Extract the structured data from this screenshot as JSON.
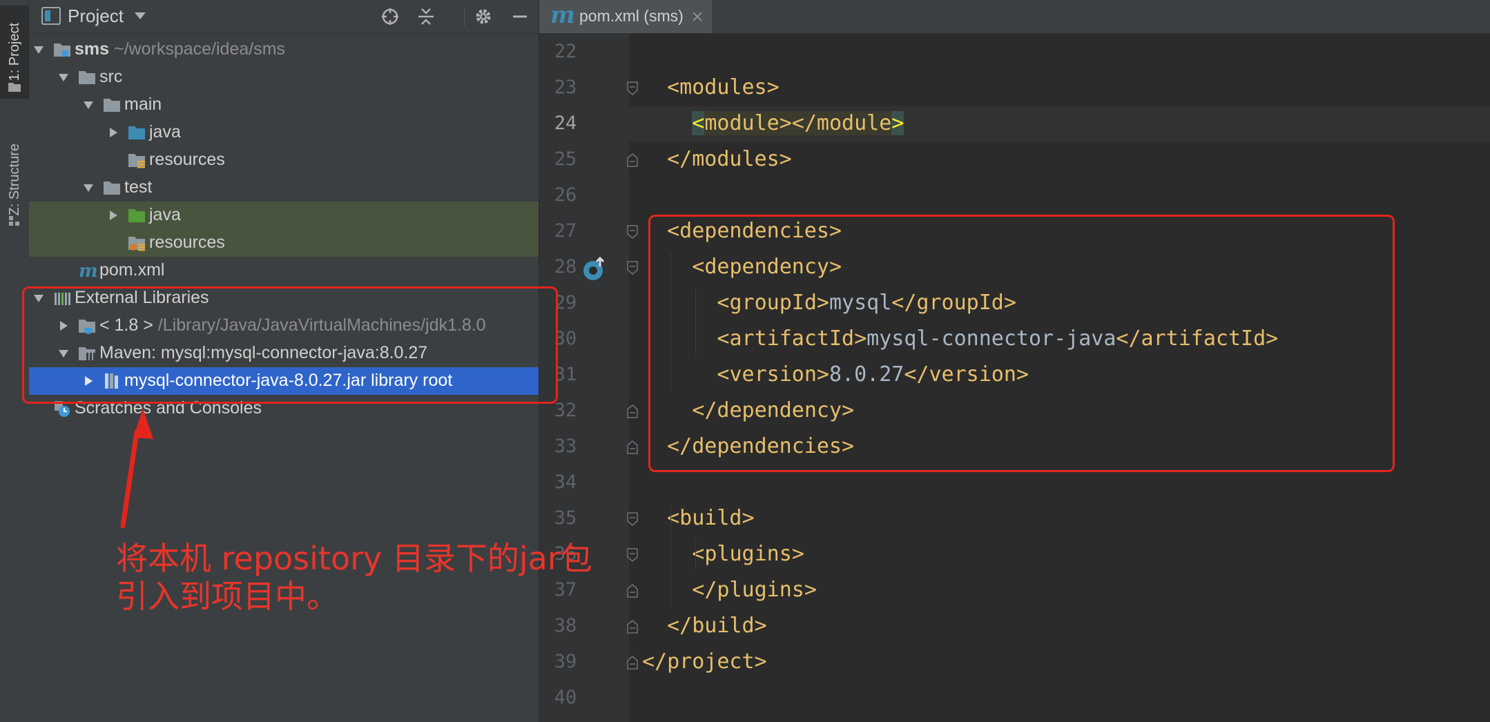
{
  "tool_window_tabs": [
    {
      "label": "1: Project",
      "active": true
    },
    {
      "label": "Z: Structure",
      "active": false
    }
  ],
  "project_panel": {
    "title": "Project",
    "header_icons": [
      "crosshair-icon",
      "collapse-all-icon",
      "gear-icon",
      "minimize-icon"
    ],
    "tree": [
      {
        "id": "sms",
        "level": 0,
        "expanded": true,
        "icon": "module-folder-icon",
        "label": "sms",
        "bold": true,
        "hint": "~/workspace/idea/sms"
      },
      {
        "id": "src",
        "level": 1,
        "expanded": true,
        "icon": "folder-icon",
        "label": "src",
        "hint": ""
      },
      {
        "id": "main",
        "level": 2,
        "expanded": true,
        "icon": "folder-icon",
        "label": "main",
        "hint": ""
      },
      {
        "id": "main-java",
        "level": 3,
        "expanded": false,
        "icon": "source-root-folder-icon",
        "label": "java",
        "hint": ""
      },
      {
        "id": "main-resources",
        "level": 3,
        "expanded": null,
        "icon": "resources-folder-icon",
        "label": "resources",
        "hint": ""
      },
      {
        "id": "test",
        "level": 2,
        "expanded": true,
        "icon": "folder-icon",
        "label": "test",
        "hint": ""
      },
      {
        "id": "test-java",
        "level": 3,
        "expanded": false,
        "icon": "test-source-folder-icon",
        "label": "java",
        "hint": "",
        "highlight": "test"
      },
      {
        "id": "test-resources",
        "level": 3,
        "expanded": null,
        "icon": "test-resources-folder-icon",
        "label": "resources",
        "hint": "",
        "highlight": "test"
      },
      {
        "id": "pom",
        "level": 1,
        "expanded": null,
        "icon": "maven-file-icon",
        "label": "pom.xml",
        "hint": ""
      },
      {
        "id": "ext-libs",
        "level": 0,
        "expanded": true,
        "icon": "libraries-icon",
        "label": "External Libraries",
        "hint": ""
      },
      {
        "id": "jdk",
        "level": 1,
        "expanded": false,
        "icon": "jdk-icon",
        "label": "< 1.8 >",
        "hint": "/Library/Java/JavaVirtualMachines/jdk1.8.0"
      },
      {
        "id": "maven-lib",
        "level": 1,
        "expanded": true,
        "icon": "library-icon",
        "label": "Maven: mysql:mysql-connector-java:8.0.27",
        "hint": ""
      },
      {
        "id": "jar",
        "level": 2,
        "expanded": false,
        "icon": "jar-icon",
        "label": "mysql-connector-java-8.0.27.jar",
        "hint": "library root",
        "selected": true
      },
      {
        "id": "scratches",
        "level": 0,
        "expanded": null,
        "icon": "scratches-icon",
        "label": "Scratches and Consoles",
        "hint": ""
      }
    ]
  },
  "editor": {
    "tab_label": "pom.xml (sms)",
    "tab_icon": "maven-file-icon",
    "current_line": 24,
    "lines": [
      {
        "n": 22,
        "indent": 0,
        "text": ""
      },
      {
        "n": 23,
        "indent": 1,
        "text": "<modules>",
        "fold": "open"
      },
      {
        "n": 24,
        "indent": 2,
        "text": "<module></module>",
        "highlight": true
      },
      {
        "n": 25,
        "indent": 1,
        "text": "</modules>",
        "fold": "close"
      },
      {
        "n": 26,
        "indent": 0,
        "text": ""
      },
      {
        "n": 27,
        "indent": 1,
        "text": "<dependencies>",
        "fold": "open"
      },
      {
        "n": 28,
        "indent": 2,
        "text": "<dependency>",
        "fold": "open",
        "gutter_icon": "maven-implemented-icon"
      },
      {
        "n": 29,
        "indent": 3,
        "parts": [
          "<groupId>",
          "mysql",
          "</groupId>"
        ]
      },
      {
        "n": 30,
        "indent": 3,
        "parts": [
          "<artifactId>",
          "mysql-connector-java",
          "</artifactId>"
        ]
      },
      {
        "n": 31,
        "indent": 3,
        "parts": [
          "<version>",
          "8.0.27",
          "</version>"
        ]
      },
      {
        "n": 32,
        "indent": 2,
        "text": "</dependency>",
        "fold": "close"
      },
      {
        "n": 33,
        "indent": 1,
        "text": "</dependencies>",
        "fold": "close"
      },
      {
        "n": 34,
        "indent": 0,
        "text": ""
      },
      {
        "n": 35,
        "indent": 1,
        "text": "<build>",
        "fold": "open"
      },
      {
        "n": 36,
        "indent": 2,
        "text": "<plugins>",
        "fold": "open"
      },
      {
        "n": 37,
        "indent": 2,
        "text": "</plugins>",
        "fold": "close"
      },
      {
        "n": 38,
        "indent": 1,
        "text": "</build>",
        "fold": "close"
      },
      {
        "n": 39,
        "indent": 0,
        "text": "</project>",
        "fold": "close"
      },
      {
        "n": 40,
        "indent": 0,
        "text": ""
      }
    ]
  },
  "annotation": {
    "line1": "将本机 repository 目录下的jar包",
    "line2": "引入到项目中。",
    "color": "#e4251c"
  },
  "colors": {
    "tag": "#e8bf6a",
    "text": "#a9b7c6",
    "selection": "#2f65ca",
    "test_highlight": "#49543f",
    "source_folder": "#3d8cb5",
    "test_folder": "#549c3a"
  }
}
